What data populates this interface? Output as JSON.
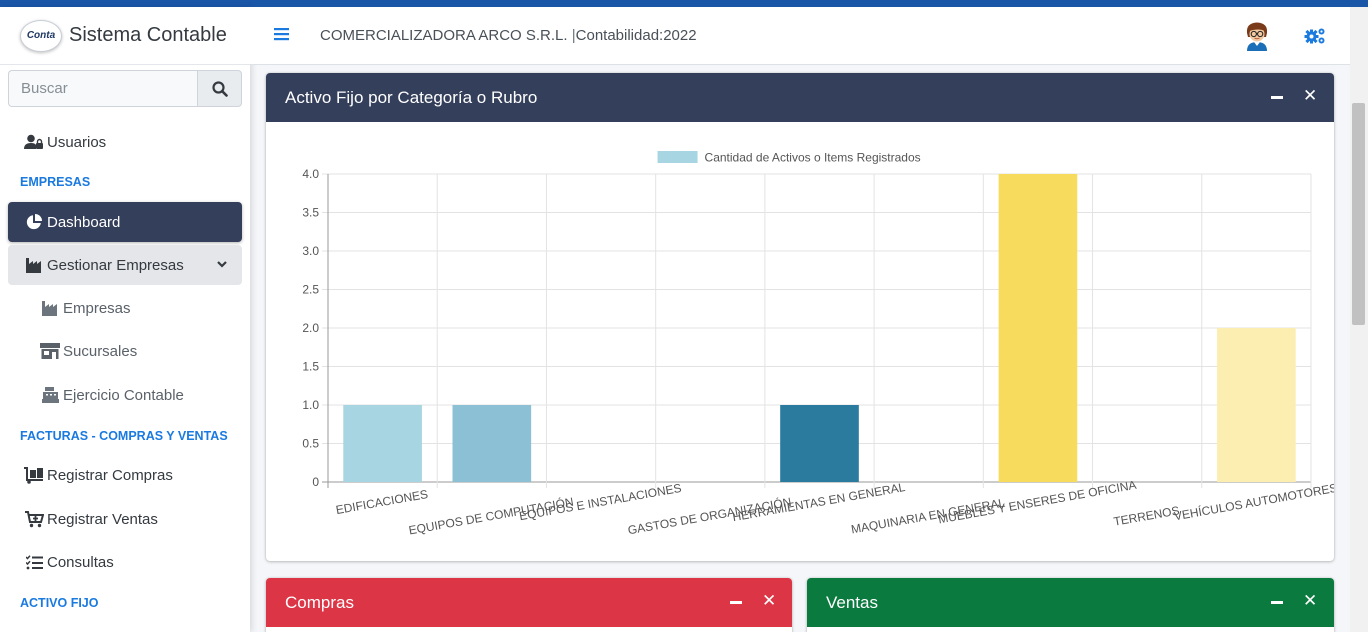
{
  "app": {
    "brand_logo_text": "Conta",
    "brand_name": "Sistema Contable"
  },
  "search": {
    "placeholder": "Buscar"
  },
  "sidebar": {
    "usuarios": "Usuarios",
    "section_empresas": "EMPRESAS",
    "dashboard": "Dashboard",
    "gestionar_empresas": "Gestionar Empresas",
    "empresas": "Empresas",
    "sucursales": "Sucursales",
    "ejercicio_contable": "Ejercicio Contable",
    "section_facturas": "FACTURAS - COMPRAS Y VENTAS",
    "registrar_compras": "Registrar Compras",
    "registrar_ventas": "Registrar Ventas",
    "consultas": "Consultas",
    "section_activo_fijo": "ACTIVO FIJO"
  },
  "navbar": {
    "company": "COMERCIALIZADORA ARCO S.R.L.",
    "separator": "|",
    "period": "Contabilidad:2022"
  },
  "cards": {
    "activo_fijo_title": "Activo Fijo por Categoría o Rubro",
    "compras_title": "Compras",
    "ventas_title": "Ventas",
    "activo_fijo_color": "#343f5c",
    "compras_color": "#dc3545",
    "ventas_color": "#0a7a3e"
  },
  "chart_data": {
    "type": "bar",
    "categories": [
      "EDIFICACIONES",
      "EQUIPOS DE COMPUTACIÓN",
      "EQUIPOS E INSTALACIONES",
      "GASTOS DE ORGANIZACIÓN",
      "HERRAMIENTAS EN GENERAL",
      "MAQUINARIA EN GENERAL",
      "MUEBLES Y ENSERES DE OFICINA",
      "TERRENOS",
      "VEHÍCULOS AUTOMOTORES"
    ],
    "series": [
      {
        "name": "Cantidad de Activos o Items Registrados",
        "values": [
          1,
          1,
          0,
          0,
          1,
          0,
          4,
          0,
          2
        ],
        "colors": [
          "#a8d5e2",
          "#8bc0d5",
          "#5fa3c3",
          "#4a90b0",
          "#2b7b9e",
          "#e8c95a",
          "#f7db5c",
          "#f8e07a",
          "#fbeeb0"
        ]
      }
    ],
    "legend_color": "#a8d5e2",
    "yticks": [
      "0",
      "0.5",
      "1.0",
      "1.5",
      "2.0",
      "2.5",
      "3.0",
      "3.5",
      "4.0"
    ],
    "ylim": [
      0,
      4
    ],
    "grid": true,
    "legend": "top-center"
  }
}
